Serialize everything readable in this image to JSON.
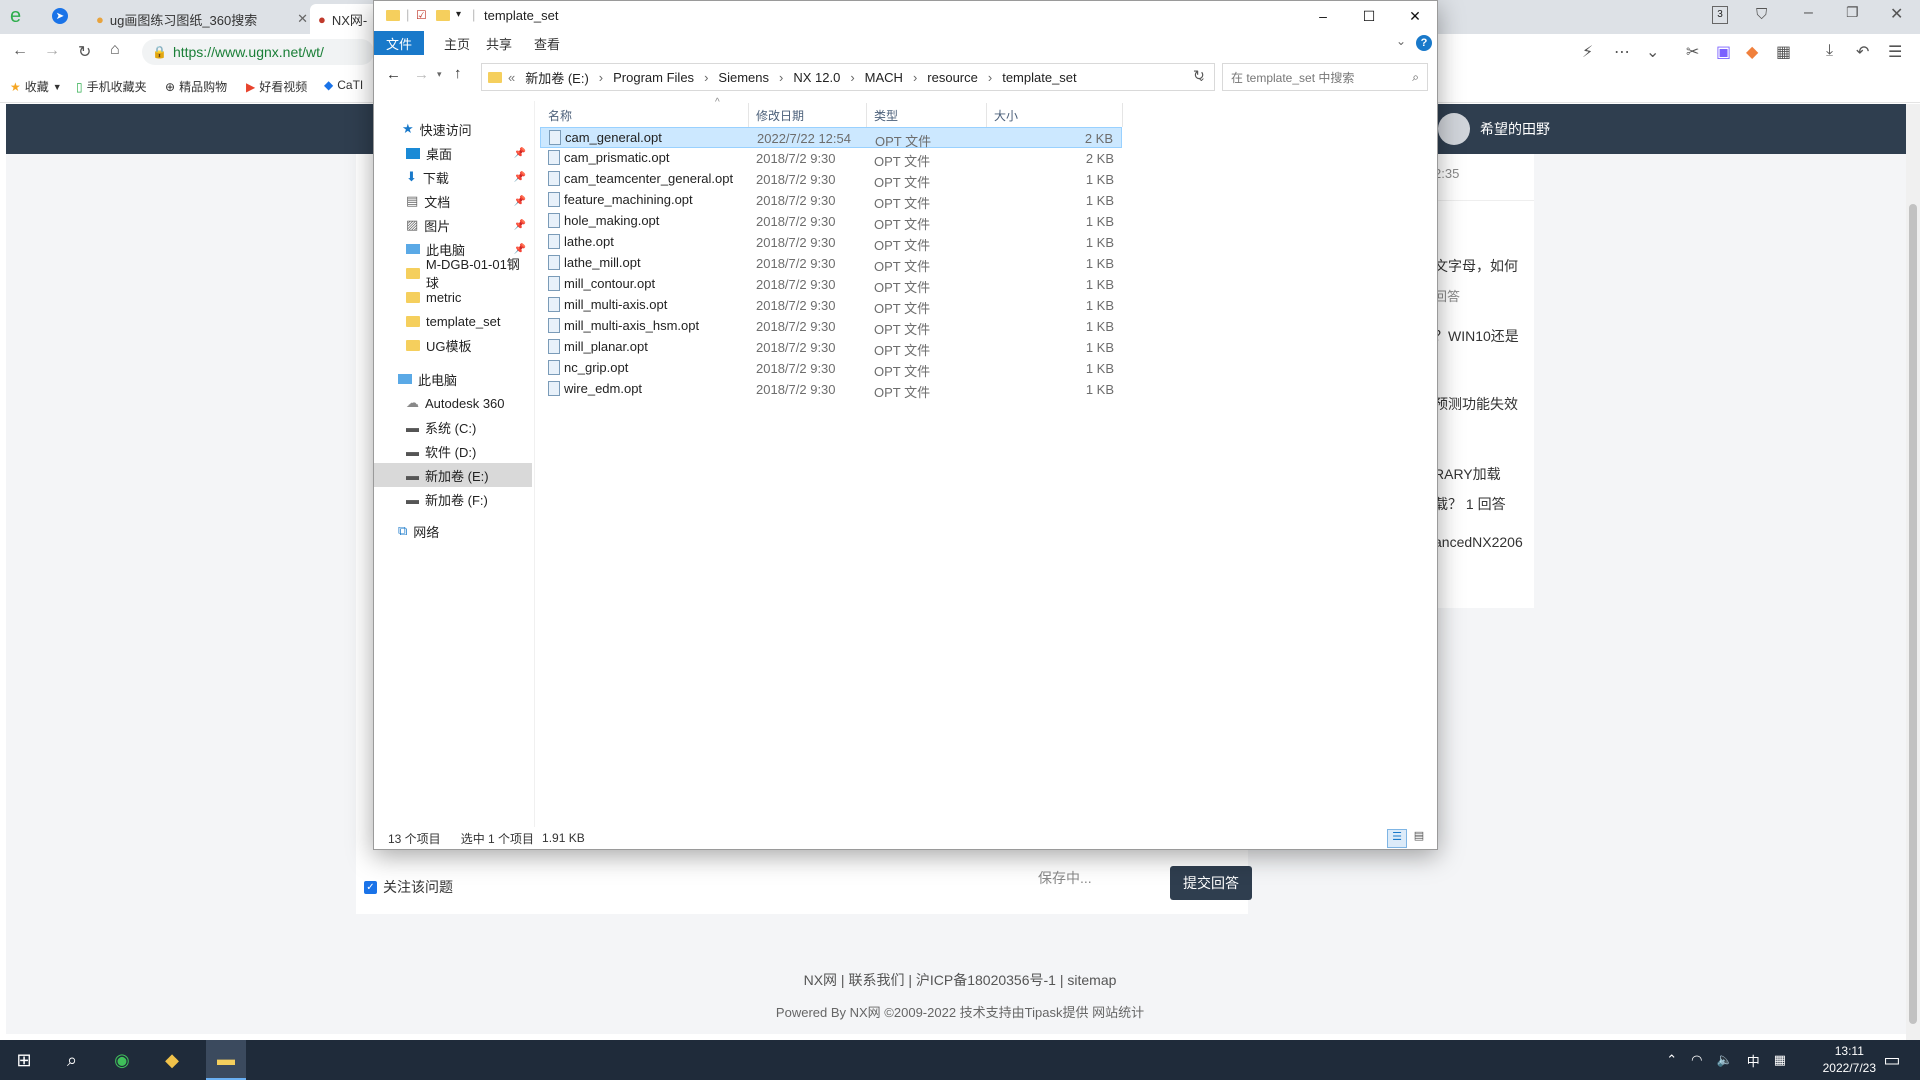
{
  "browser": {
    "tabs": [
      {
        "label": "ug画图练习图纸_360搜索"
      },
      {
        "label": "NX网-"
      }
    ],
    "tab_badge": "3",
    "url": "https://www.ugnx.net/wt/",
    "bookmarks": [
      "收藏",
      "手机收藏夹",
      "精品购物",
      "好看视频",
      "CaTI"
    ]
  },
  "site": {
    "username": "希望的田野",
    "side_items": [
      {
        "text": "2:35"
      },
      {
        "text": "文字母，如何"
      },
      {
        "text": "回答"
      },
      {
        "text": "？WIN10还是"
      },
      {
        "text": "预测功能失效"
      },
      {
        "text": "RARY加载"
      },
      {
        "text": "载？  1 回答"
      },
      {
        "text": "ancedNX2206"
      }
    ],
    "follow_label": "关注该问题",
    "saving": "保存中...",
    "submit": "提交回答",
    "footer_links": "NX网  |   联系我们  |   沪ICP备18020356号-1  |   sitemap",
    "footer_copy": "Powered By NX网 ©2009-2022 技术支持由Tipask提供 网站统计"
  },
  "explorer": {
    "title": "template_set",
    "ribbon_tabs": [
      "文件",
      "主页",
      "共享",
      "查看"
    ],
    "breadcrumb": [
      "新加卷 (E:)",
      "Program Files",
      "Siemens",
      "NX 12.0",
      "MACH",
      "resource",
      "template_set"
    ],
    "search_placeholder": "在 template_set 中搜索",
    "nav": {
      "quick_access": "快速访问",
      "items": [
        "桌面",
        "下载",
        "文档",
        "图片",
        "此电脑",
        "M-DGB-01-01钢球",
        "metric",
        "template_set",
        "UG模板"
      ],
      "this_pc": "此电脑",
      "drives": [
        "Autodesk 360",
        "系统 (C:)",
        "软件 (D:)",
        "新加卷 (E:)",
        "新加卷 (F:)"
      ],
      "network": "网络"
    },
    "columns": {
      "name": "名称",
      "date": "修改日期",
      "type": "类型",
      "size": "大小"
    },
    "files": [
      {
        "name": "cam_general.opt",
        "date": "2022/7/22 12:54",
        "type": "OPT 文件",
        "size": "2 KB"
      },
      {
        "name": "cam_prismatic.opt",
        "date": "2018/7/2 9:30",
        "type": "OPT 文件",
        "size": "2 KB"
      },
      {
        "name": "cam_teamcenter_general.opt",
        "date": "2018/7/2 9:30",
        "type": "OPT 文件",
        "size": "1 KB"
      },
      {
        "name": "feature_machining.opt",
        "date": "2018/7/2 9:30",
        "type": "OPT 文件",
        "size": "1 KB"
      },
      {
        "name": "hole_making.opt",
        "date": "2018/7/2 9:30",
        "type": "OPT 文件",
        "size": "1 KB"
      },
      {
        "name": "lathe.opt",
        "date": "2018/7/2 9:30",
        "type": "OPT 文件",
        "size": "1 KB"
      },
      {
        "name": "lathe_mill.opt",
        "date": "2018/7/2 9:30",
        "type": "OPT 文件",
        "size": "1 KB"
      },
      {
        "name": "mill_contour.opt",
        "date": "2018/7/2 9:30",
        "type": "OPT 文件",
        "size": "1 KB"
      },
      {
        "name": "mill_multi-axis.opt",
        "date": "2018/7/2 9:30",
        "type": "OPT 文件",
        "size": "1 KB"
      },
      {
        "name": "mill_multi-axis_hsm.opt",
        "date": "2018/7/2 9:30",
        "type": "OPT 文件",
        "size": "1 KB"
      },
      {
        "name": "mill_planar.opt",
        "date": "2018/7/2 9:30",
        "type": "OPT 文件",
        "size": "1 KB"
      },
      {
        "name": "nc_grip.opt",
        "date": "2018/7/2 9:30",
        "type": "OPT 文件",
        "size": "1 KB"
      },
      {
        "name": "wire_edm.opt",
        "date": "2018/7/2 9:30",
        "type": "OPT 文件",
        "size": "1 KB"
      }
    ],
    "status": {
      "count": "13 个项目",
      "selected": "选中 1 个项目",
      "size": "1.91 KB"
    }
  },
  "taskbar": {
    "ime": "中",
    "time": "13:11",
    "date": "2022/7/23"
  }
}
